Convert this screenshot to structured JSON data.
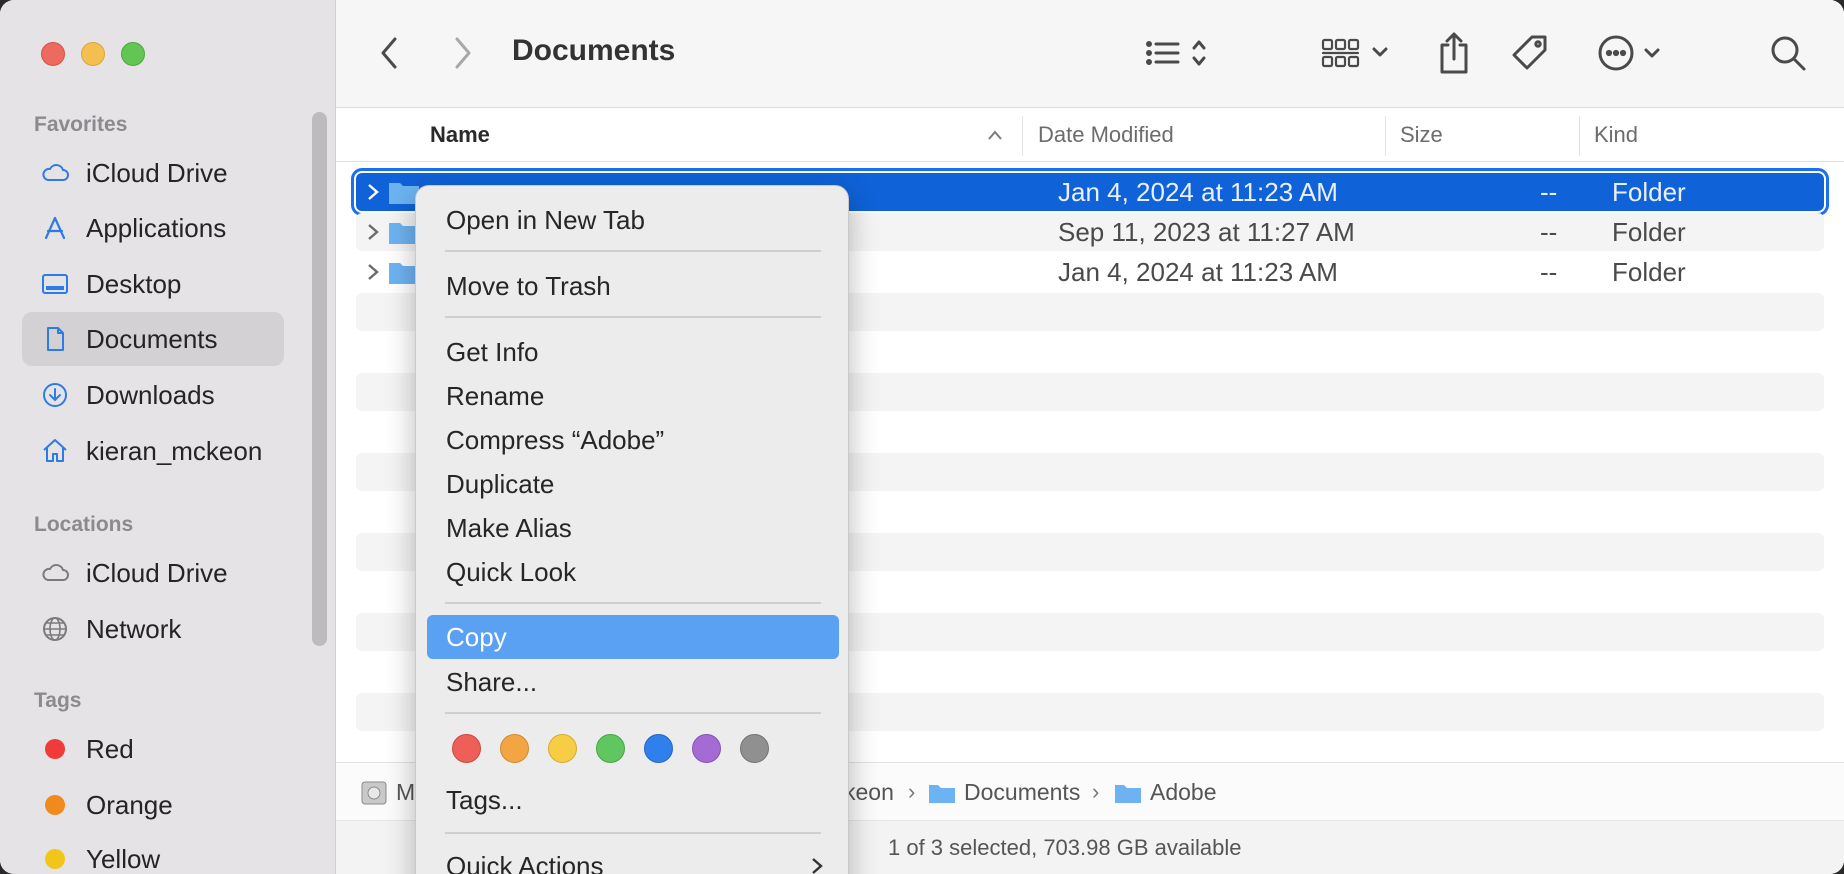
{
  "window": {
    "title": "Documents"
  },
  "sidebar": {
    "favorites_label": "Favorites",
    "favorites": [
      {
        "label": "iCloud Drive",
        "icon": "cloud-icon"
      },
      {
        "label": "Applications",
        "icon": "applications-icon"
      },
      {
        "label": "Desktop",
        "icon": "desktop-icon"
      },
      {
        "label": "Documents",
        "icon": "document-icon",
        "selected": true
      },
      {
        "label": "Downloads",
        "icon": "download-icon"
      },
      {
        "label": "kieran_mckeon",
        "icon": "home-icon"
      }
    ],
    "locations_label": "Locations",
    "locations": [
      {
        "label": "iCloud Drive",
        "icon": "cloud-icon"
      },
      {
        "label": "Network",
        "icon": "globe-icon"
      }
    ],
    "tags_label": "Tags",
    "tags": [
      {
        "label": "Red",
        "color": "#f03b38"
      },
      {
        "label": "Orange",
        "color": "#f08a1c"
      },
      {
        "label": "Yellow",
        "color": "#f2c51b"
      }
    ]
  },
  "toolbar": {
    "title": "Documents",
    "icons": [
      "back-icon",
      "forward-icon",
      "list-view-icon",
      "group-icon",
      "share-icon",
      "tag-icon",
      "more-icon",
      "search-icon"
    ]
  },
  "columns": {
    "name": "Name",
    "date": "Date Modified",
    "size": "Size",
    "kind": "Kind"
  },
  "rows": [
    {
      "name": "Adobe",
      "date": "Jan 4, 2024 at 11:23 AM",
      "size": "--",
      "kind": "Folder",
      "selected": true
    },
    {
      "name": "",
      "date": "Sep 11, 2023 at 11:27 AM",
      "size": "--",
      "kind": "Folder"
    },
    {
      "name": "",
      "date": "Jan 4, 2024 at 11:23 AM",
      "size": "--",
      "kind": "Folder"
    }
  ],
  "pathbar": {
    "disk": "M",
    "user": "keon",
    "documents": "Documents",
    "adobe": "Adobe"
  },
  "status": "1 of 3 selected, 703.98 GB available",
  "context_menu": {
    "open_new_tab": "Open in New Tab",
    "move_to_trash": "Move to Trash",
    "get_info": "Get Info",
    "rename": "Rename",
    "compress": "Compress “Adobe”",
    "duplicate": "Duplicate",
    "make_alias": "Make Alias",
    "quick_look": "Quick Look",
    "copy": "Copy",
    "share": "Share...",
    "tags": "Tags...",
    "quick_actions": "Quick Actions",
    "tag_colors": [
      "#ee5f57",
      "#f3a543",
      "#f6cd45",
      "#5fc660",
      "#2f80ec",
      "#a46bd5",
      "#909090"
    ]
  }
}
